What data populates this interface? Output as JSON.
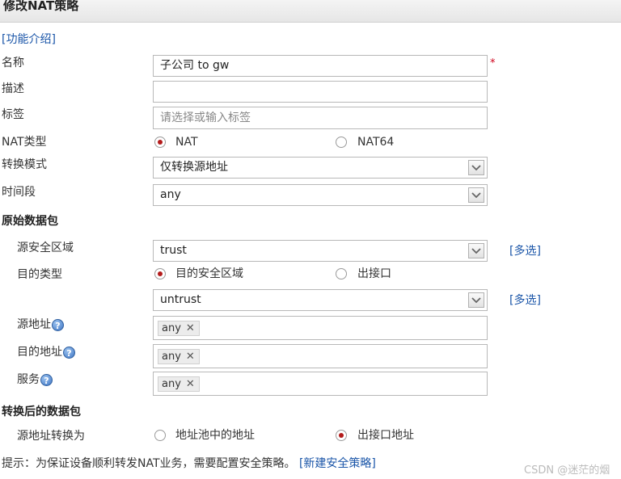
{
  "title": "修改NAT策略",
  "intro_link": "[功能介绍]",
  "fields": {
    "name_label": "名称",
    "name_value": "子公司 to gw",
    "required_mark": "*",
    "desc_label": "描述",
    "desc_value": "",
    "tag_label": "标签",
    "tag_placeholder": "请选择或输入标签",
    "nat_type_label": "NAT类型",
    "nat_type_options": [
      "NAT",
      "NAT64"
    ],
    "nat_type_selected": "NAT",
    "mode_label": "转换模式",
    "mode_value": "仅转换源地址",
    "time_label": "时间段",
    "time_value": "any"
  },
  "original": {
    "section": "原始数据包",
    "src_zone_label": "源安全区域",
    "src_zone_value": "trust",
    "multi_select": "[多选]",
    "dst_type_label": "目的类型",
    "dst_type_options": [
      "目的安全区域",
      "出接口"
    ],
    "dst_type_selected": "目的安全区域",
    "dst_zone_value": "untrust",
    "src_addr_label": "源地址",
    "src_addr_tag": "any",
    "dst_addr_label": "目的地址",
    "dst_addr_tag": "any",
    "service_label": "服务",
    "service_tag": "any",
    "help_glyph": "?",
    "remove_glyph": "✕"
  },
  "translated": {
    "section": "转换后的数据包",
    "src_translate_label": "源地址转换为",
    "options": [
      "地址池中的地址",
      "出接口地址"
    ],
    "selected": "出接口地址"
  },
  "footer": {
    "hint": "提示：为保证设备顺利转发NAT业务，需要配置安全策略。",
    "new_policy_link": "[新建安全策略]",
    "watermark": "CSDN @迷茫的烟"
  },
  "icons": {
    "dropdown": "chevron-down-icon",
    "help": "help-icon",
    "remove": "close-icon"
  },
  "colors": {
    "link": "#1a55a8",
    "radio_selected": "#b31b1b",
    "required": "#d0021b"
  }
}
